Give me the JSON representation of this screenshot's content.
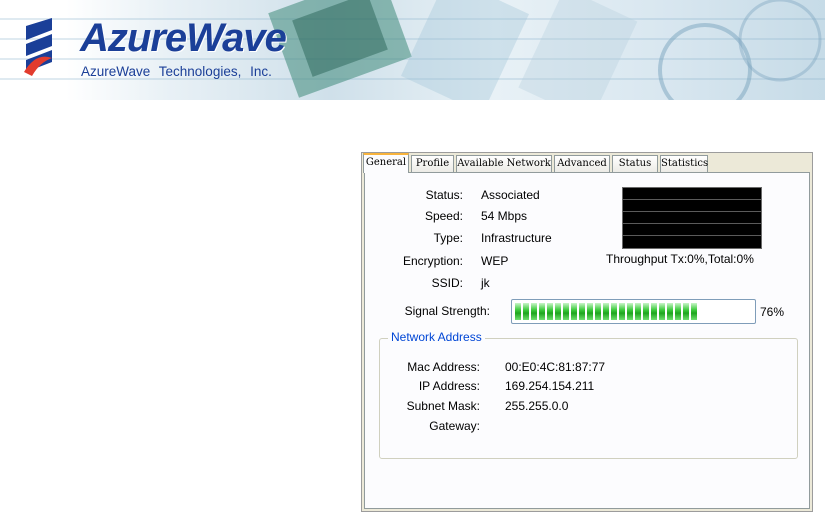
{
  "banner": {
    "brand": "AzureWave",
    "company": "AzureWave Technologies, Inc."
  },
  "tabs": [
    {
      "label": "General",
      "active": true
    },
    {
      "label": "Profile",
      "active": false
    },
    {
      "label": "Available Network",
      "active": false
    },
    {
      "label": "Advanced",
      "active": false
    },
    {
      "label": "Status",
      "active": false
    },
    {
      "label": "Statistics",
      "active": false
    }
  ],
  "general": {
    "status_label": "Status:",
    "status_value": "Associated",
    "speed_label": "Speed:",
    "speed_value": "54 Mbps",
    "type_label": "Type:",
    "type_value": "Infrastructure",
    "encryption_label": "Encryption:",
    "encryption_value": "WEP",
    "ssid_label": "SSID:",
    "ssid_value": "jk",
    "throughput_text": "Throughput  Tx:0%,Total:0%",
    "signal_label": "Signal Strength:",
    "signal_value": "76%",
    "signal_fraction": 0.76
  },
  "network": {
    "title": "Network Address",
    "mac_label": "Mac Address:",
    "mac_value": "00:E0:4C:81:87:77",
    "ip_label": "IP Address:",
    "ip_value": "169.254.154.211",
    "mask_label": "Subnet Mask:",
    "mask_value": "255.255.0.0",
    "gateway_label": "Gateway:",
    "gateway_value": ""
  },
  "colors": {
    "brand_blue": "#1b3f98",
    "tab_highlight": "#f8b33c",
    "group_title": "#0046d5",
    "signal_green": "#2dbf2d"
  }
}
